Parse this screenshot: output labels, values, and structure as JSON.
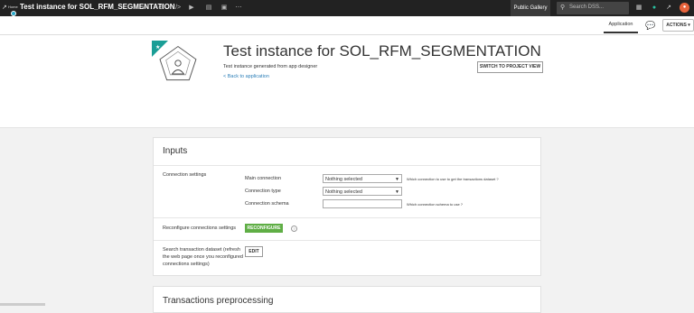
{
  "topbar": {
    "home_label": "Home",
    "title": "Test instance for SOL_RFM_SEGMENTATION",
    "public_gallery": "Public Gallery",
    "search_placeholder": "Search DSS..."
  },
  "subbar": {
    "application_tab": "Application",
    "actions_label": "ACTIONS"
  },
  "header": {
    "title": "Test instance for SOL_RFM_SEGMENTATION",
    "subtitle": "Test instance generated from app designer",
    "back_link": "< Back to application",
    "switch_button": "SWITCH TO PROJECT VIEW"
  },
  "inputs": {
    "title": "Inputs",
    "connection_settings_label": "Connection settings",
    "main_connection_label": "Main connection",
    "main_connection_value": "Nothing selected",
    "main_connection_help": "Which connection to use to get the transactions dataset ?",
    "connection_type_label": "Connection type",
    "connection_type_value": "Nothing selected",
    "connection_schema_label": "Connection schema",
    "connection_schema_help": "Which connection schema to use ?",
    "reconfigure_label": "Reconfigure connections settings",
    "reconfigure_button": "RECONFIGURE",
    "search_dataset_label": "Search transaction dataset (refresh the web page once you reconfigured connections settings)",
    "edit_button": "EDIT"
  },
  "preprocessing": {
    "title": "Transactions preprocessing"
  },
  "colors": {
    "topbar": "#222222",
    "accent_green": "#5fae45",
    "badge_teal": "#1a9e96",
    "link_blue": "#2c7fb8"
  }
}
